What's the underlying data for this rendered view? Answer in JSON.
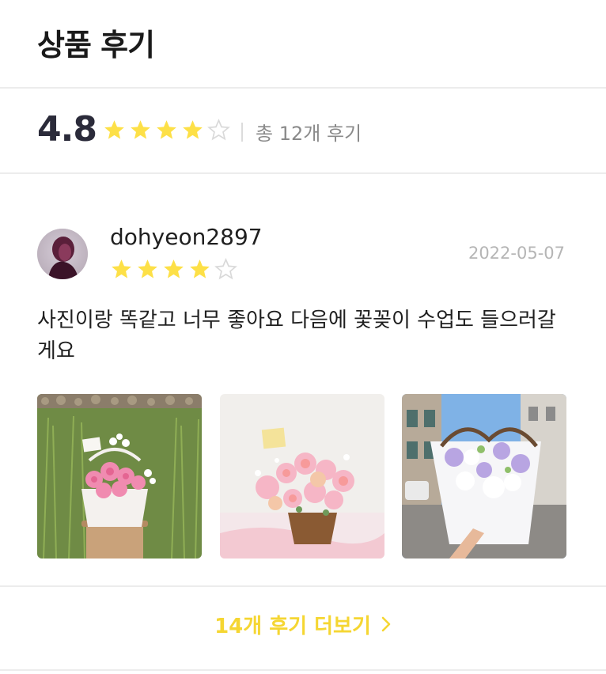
{
  "header": {
    "title": "상품 후기"
  },
  "summary": {
    "average": "4.8",
    "stars": [
      1,
      1,
      1,
      1,
      0
    ],
    "total_text": "총 12개 후기"
  },
  "review": {
    "username": "dohyeon2897",
    "date": "2022-05-07",
    "stars": [
      1,
      1,
      1,
      1,
      0
    ],
    "text": "사진이랑 똑같고 너무 좋아요 다음에 꽃꽂이 수업도 들으러갈게요",
    "photos": [
      "photo-flower-basket-field",
      "photo-flower-basket-pink",
      "photo-flower-bouquet-purple"
    ]
  },
  "more": {
    "label": "14개 후기 더보기"
  },
  "colors": {
    "star_filled": "#fde047",
    "star_empty": "#d9d9d9",
    "accent": "#f5d632"
  },
  "icons": {
    "star": "star-icon",
    "chevron": "chevron-right-icon"
  }
}
